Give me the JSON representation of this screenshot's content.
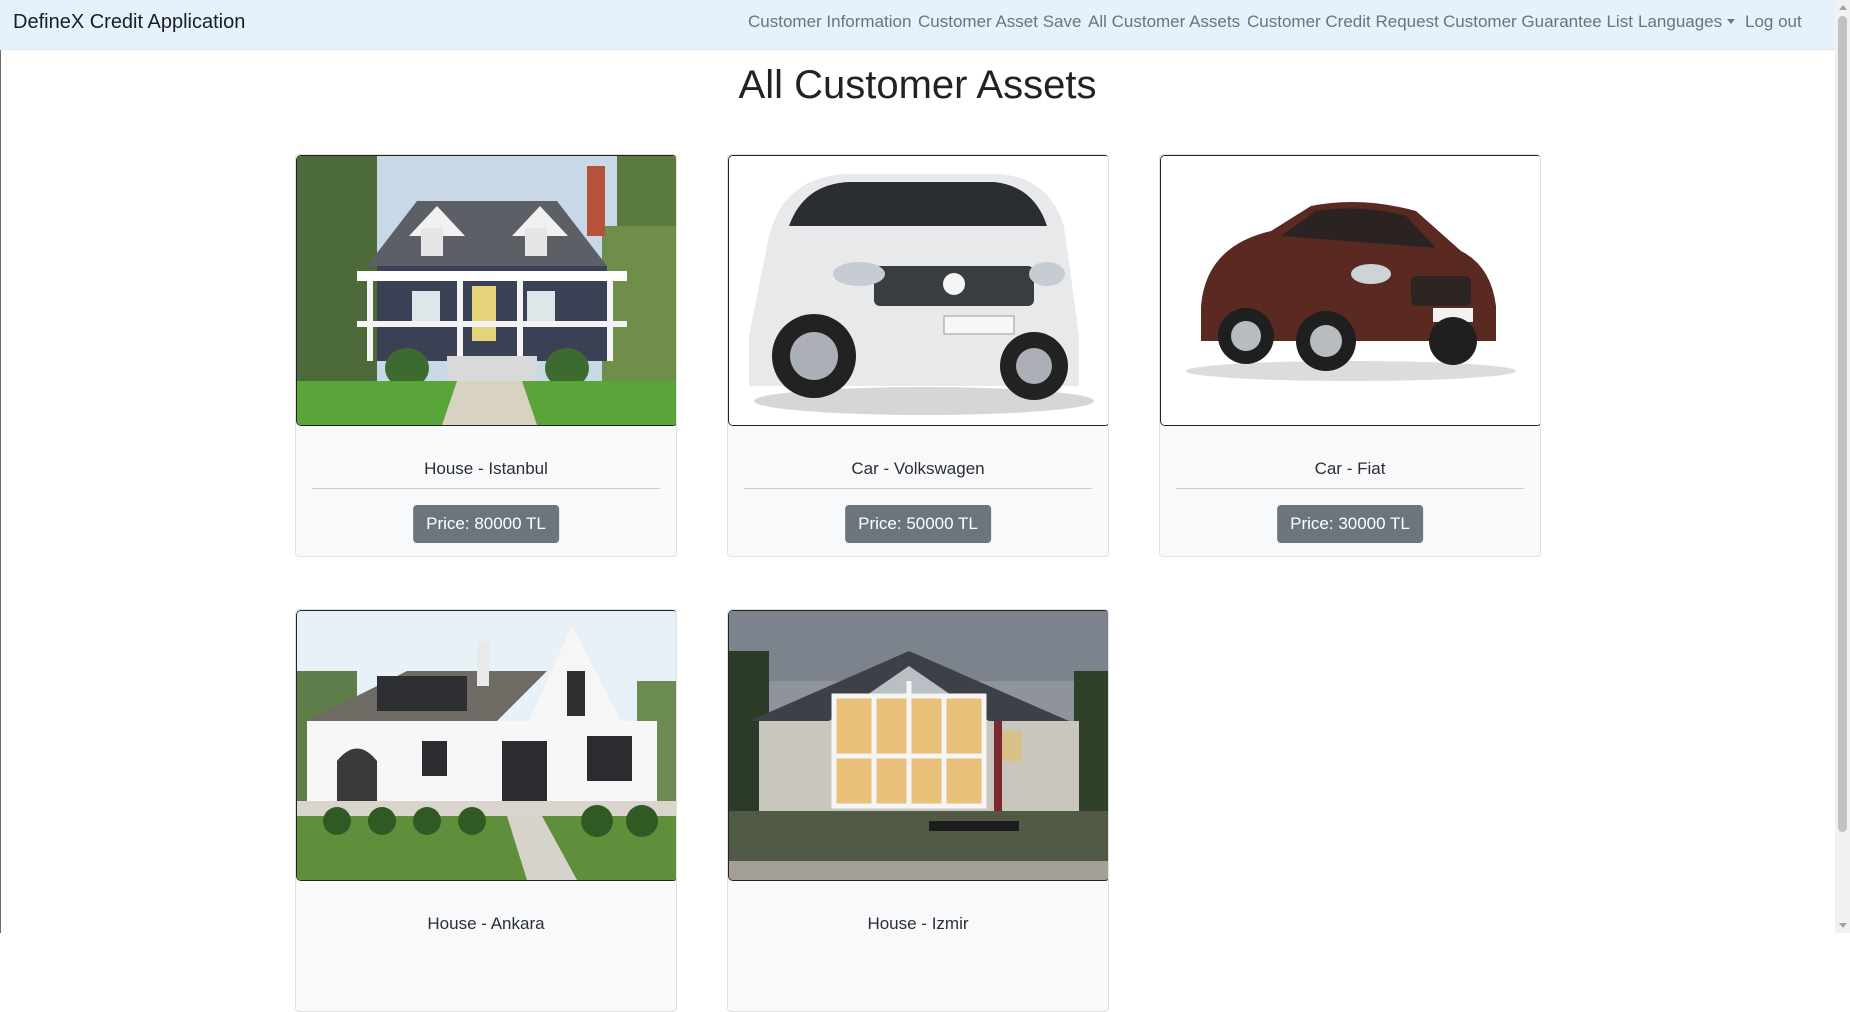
{
  "navbar": {
    "brand": "DefineX Credit Application",
    "links": [
      {
        "label": "Customer Information"
      },
      {
        "label": "Customer Asset Save"
      },
      {
        "label": "All Customer Assets"
      },
      {
        "label": "Customer Credit Request"
      },
      {
        "label": "Customer Guarantee List"
      },
      {
        "label": "Languages",
        "dropdown": true
      },
      {
        "label": "Log out"
      }
    ]
  },
  "page": {
    "title": "All Customer Assets"
  },
  "assets": [
    {
      "name": "House - Istanbul",
      "price": "Price: 80000 TL",
      "image": "white-blue-house-photo"
    },
    {
      "name": "Car - Volkswagen",
      "price": "Price: 50000 TL",
      "image": "silver-suv-photo"
    },
    {
      "name": "Car - Fiat",
      "price": "Price: 30000 TL",
      "image": "brown-sedan-photo"
    },
    {
      "name": "House - Ankara",
      "price": "",
      "image": "white-cottage-photo"
    },
    {
      "name": "House - Izmir",
      "price": "",
      "image": "sunroom-house-photo"
    }
  ],
  "colors": {
    "navbar_bg": "#e3f2fd",
    "price_button": "#6c757d",
    "card_bg": "#f8f9fa"
  }
}
